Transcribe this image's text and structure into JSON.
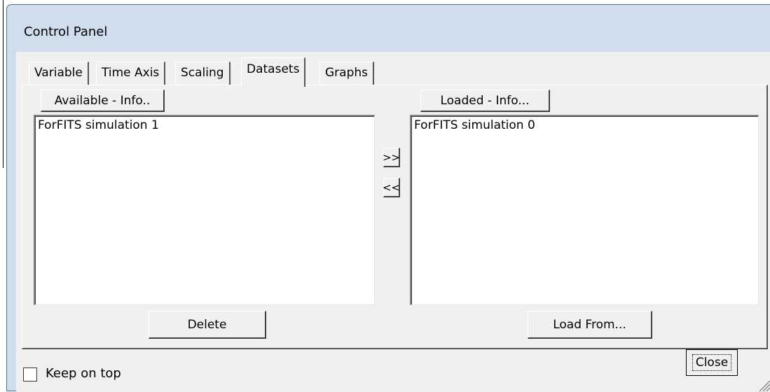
{
  "window": {
    "title": "Control Panel"
  },
  "tabs": [
    {
      "label": "Variable",
      "active": false
    },
    {
      "label": "Time Axis",
      "active": false
    },
    {
      "label": "Scaling",
      "active": false
    },
    {
      "label": "Datasets",
      "active": true
    },
    {
      "label": "Graphs",
      "active": false
    }
  ],
  "available": {
    "info_button": "Available - Info..",
    "items": [
      "ForFITS simulation 1"
    ],
    "delete_button": "Delete"
  },
  "transfer": {
    "add_button": ">>",
    "remove_button": "<<"
  },
  "loaded": {
    "info_button": "Loaded - Info...",
    "items": [
      "ForFITS simulation 0"
    ],
    "load_button": "Load From..."
  },
  "footer": {
    "keep_on_top_label": "Keep on top",
    "keep_on_top_checked": false,
    "close_button": "Close"
  }
}
